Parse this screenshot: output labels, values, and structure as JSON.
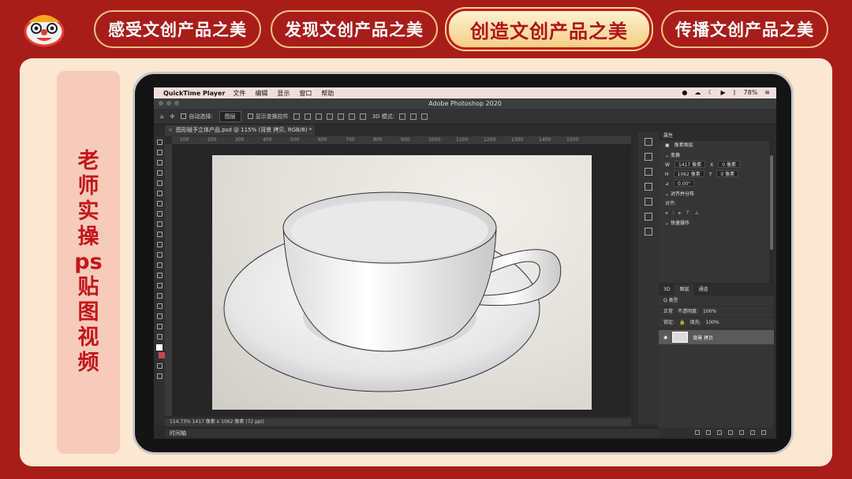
{
  "nav": {
    "tabs": [
      {
        "label": "感受文创产品之美"
      },
      {
        "label": "发现文创产品之美"
      },
      {
        "label": "创造文创产品之美"
      },
      {
        "label": "传播文创产品之美"
      }
    ]
  },
  "side_label": [
    "老",
    "师",
    "实",
    "操",
    "ps",
    "贴",
    "图",
    "视",
    "频"
  ],
  "mac_menu": {
    "app": "QuickTime Player",
    "items": [
      "文件",
      "编辑",
      "显示",
      "窗口",
      "帮助"
    ],
    "battery": "78%"
  },
  "ps": {
    "title": "Adobe Photoshop 2020",
    "options": {
      "auto_select": "自动选择:",
      "auto_select_value": "图层",
      "show_transform": "显示变换控件",
      "mode_3d": "3D 模式:"
    },
    "doc_tab": "图形赋予立体产品.psd @ 115% (背景 拷贝, RGB/8) *",
    "ruler_marks": [
      "100",
      "200",
      "300",
      "400",
      "500",
      "600",
      "700",
      "800",
      "900",
      "1000",
      "1100",
      "1200",
      "1300",
      "1400",
      "1500"
    ],
    "status": "114.73%    1417 像素 x 1062 像素 (72 ppi)",
    "timeline": "时间轴",
    "properties": {
      "tab": "属性",
      "pixel_layer": "像素图层",
      "transform": "变换",
      "w_label": "W",
      "w_value": "1417 像素",
      "x_label": "X",
      "x_value": "0 像素",
      "h_label": "H",
      "h_value": "1062 像素",
      "y_label": "Y",
      "y_value": "0 像素",
      "angle": "0.00°",
      "align": "对齐并分布",
      "align_label": "对齐:",
      "quick": "快速操作"
    },
    "layers": {
      "tabs": [
        "3D",
        "图层",
        "通道"
      ],
      "filter": "Q 类型",
      "blend": "正常",
      "opacity_label": "不透明度:",
      "opacity": "100%",
      "lock_label": "锁定:",
      "fill_label": "填充:",
      "fill": "100%",
      "layer_name": "背景 拷贝"
    }
  }
}
